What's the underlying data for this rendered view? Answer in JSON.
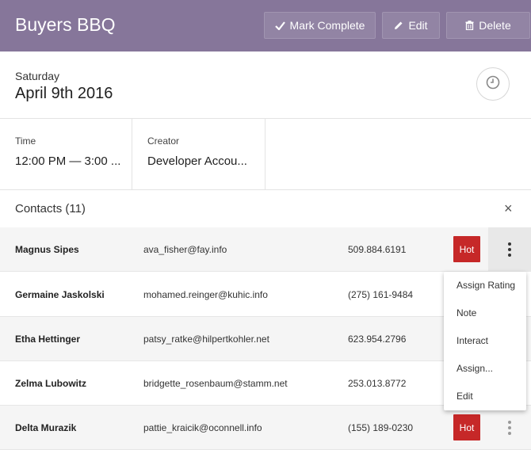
{
  "header": {
    "title": "Buyers BBQ",
    "mark_complete_label": "Mark Complete",
    "edit_label": "Edit",
    "delete_label": "Delete",
    "color": "#86769a"
  },
  "event": {
    "day": "Saturday",
    "date": "April 9th 2016"
  },
  "info": {
    "time_label": "Time",
    "time_value": "12:00 PM — 3:00 ...",
    "creator_label": "Creator",
    "creator_value": "Developer Accou..."
  },
  "contacts": {
    "title": "Contacts (11)",
    "close_icon": "×",
    "rows": [
      {
        "name": "Magnus Sipes",
        "email": "ava_fisher@fay.info",
        "phone": "509.884.6191",
        "badge": "Hot"
      },
      {
        "name": "Germaine Jaskolski",
        "email": "mohamed.reinger@kuhic.info",
        "phone": "(275) 161-9484",
        "badge": ""
      },
      {
        "name": "Etha Hettinger",
        "email": "patsy_ratke@hilpertkohler.net",
        "phone": "623.954.2796",
        "badge": ""
      },
      {
        "name": "Zelma Lubowitz",
        "email": "bridgette_rosenbaum@stamm.net",
        "phone": "253.013.8772",
        "badge": ""
      },
      {
        "name": "Delta Murazik",
        "email": "pattie_kraicik@oconnell.info",
        "phone": "(155) 189-0230",
        "badge": "Hot"
      }
    ]
  },
  "row_menu": {
    "items": [
      "Assign Rating",
      "Note",
      "Interact",
      "Assign...",
      "Edit"
    ]
  },
  "colors": {
    "hot_badge": "#c62828"
  }
}
